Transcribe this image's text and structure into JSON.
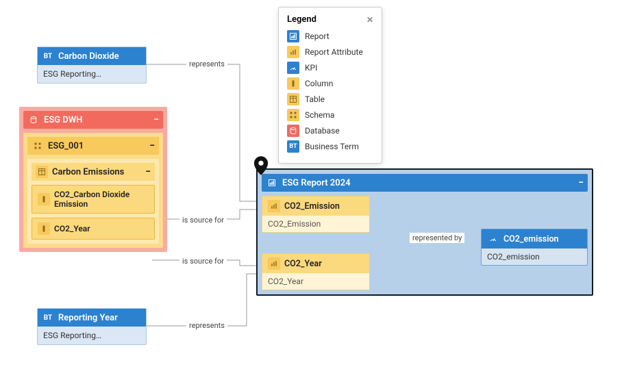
{
  "legend": {
    "title": "Legend",
    "items": [
      {
        "label": "Report"
      },
      {
        "label": "Report Attribute"
      },
      {
        "label": "KPI"
      },
      {
        "label": "Column"
      },
      {
        "label": "Table"
      },
      {
        "label": "Schema"
      },
      {
        "label": "Database"
      },
      {
        "label": "Business Term"
      }
    ]
  },
  "bt_carbon": {
    "badge": "BT",
    "title": "Carbon Dioxide",
    "subtitle": "ESG Reporting…"
  },
  "bt_year": {
    "badge": "BT",
    "title": "Reporting Year",
    "subtitle": "ESG Reporting…"
  },
  "db": {
    "title": "ESG DWH",
    "schema": {
      "title": "ESG_001",
      "table": {
        "title": "Carbon Emissions",
        "columns": [
          {
            "title": "CO2_Carbon Dioxide Emission"
          },
          {
            "title": "CO2_Year"
          }
        ]
      }
    }
  },
  "report": {
    "title": "ESG Report 2024",
    "attrs": [
      {
        "title": "CO2_Emission",
        "subtitle": "CO2_Emission"
      },
      {
        "title": "CO2_Year",
        "subtitle": "CO2_Year"
      }
    ],
    "kpi": {
      "title": "CO2_emission",
      "subtitle": "CO2_emission"
    }
  },
  "edges": {
    "e1": "represents",
    "e2": "is source for",
    "e3": "is source for",
    "e4": "represents",
    "e5": "represented by"
  }
}
